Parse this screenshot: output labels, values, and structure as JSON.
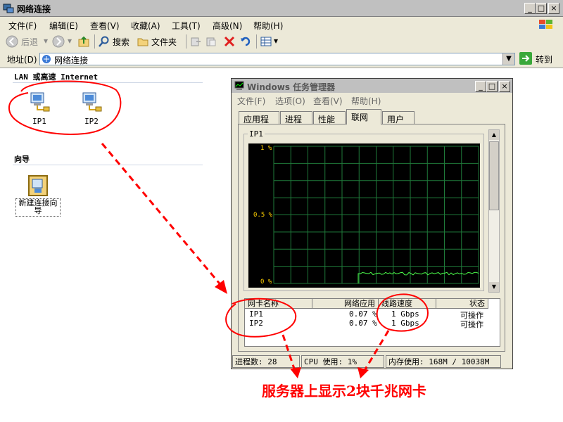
{
  "window": {
    "title": "网络连接"
  },
  "menubar": [
    "文件(F)",
    "编辑(E)",
    "查看(V)",
    "收藏(A)",
    "工具(T)",
    "高级(N)",
    "帮助(H)"
  ],
  "toolbar": {
    "back": "后退",
    "search": "搜索",
    "folders": "文件夹"
  },
  "address": {
    "label": "地址(D)",
    "value": "网络连接",
    "go": "转到"
  },
  "sections": {
    "lan": {
      "heading": "LAN 或高速 Internet",
      "items": [
        "IP1",
        "IP2"
      ]
    },
    "wizard": {
      "heading": "向导",
      "item": "新建连接向导"
    }
  },
  "taskmgr": {
    "title": "Windows 任务管理器",
    "menu": [
      "文件(F)",
      "选项(O)",
      "查看(V)",
      "帮助(H)"
    ],
    "tabs": [
      "应用程序",
      "进程",
      "性能",
      "联网",
      "用户"
    ],
    "active_tab": "联网",
    "graph": {
      "title": "IP1",
      "y_ticks": [
        "1 %",
        "0.5 %",
        "0 %"
      ]
    },
    "columns": [
      "网卡名称",
      "网络应用",
      "线路速度",
      "状态"
    ],
    "rows": [
      {
        "name": "IP1",
        "usage": "0.07 %",
        "speed": "1 Gbps",
        "state": "可操作"
      },
      {
        "name": "IP2",
        "usage": "0.07 %",
        "speed": "1 Gbps",
        "state": "可操作"
      }
    ],
    "status": {
      "processes": "进程数: 28",
      "cpu": "CPU 使用: 1%",
      "memory": "内存使用: 168M / 10038M"
    }
  },
  "annotation": {
    "caption": "服务器上显示2块千兆网卡",
    "color": "#ff0000"
  }
}
